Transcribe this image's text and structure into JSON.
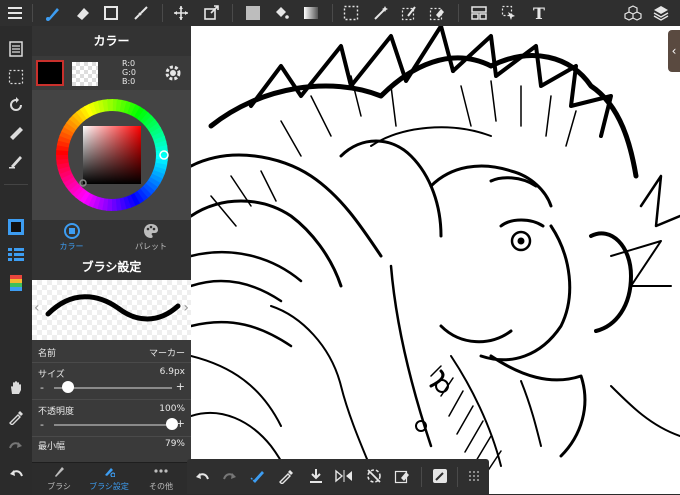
{
  "colors": {
    "accent": "#3d9df2",
    "foreground": "#000000",
    "background_swatch": "#ffffff"
  },
  "color_panel": {
    "title": "カラー",
    "rgb": {
      "r": "R:0",
      "g": "G:0",
      "b": "B:0"
    },
    "tabs": [
      {
        "label": "カラー",
        "icon": "color-circle-icon"
      },
      {
        "label": "パレット",
        "icon": "palette-icon"
      }
    ]
  },
  "brush_panel": {
    "title": "ブラシ設定",
    "name_label": "名前",
    "name_value": "マーカー",
    "size_label": "サイズ",
    "size_value": "6.9px",
    "size_level": 0.12,
    "opacity_label": "不透明度",
    "opacity_value": "100%",
    "opacity_level": 1.0,
    "min_width_label": "最小幅",
    "min_width_value": "79%"
  },
  "bottom_tabs": [
    {
      "label": "ブラシ",
      "icon": "brush-icon"
    },
    {
      "label": "ブラシ設定",
      "icon": "brush-settings-icon"
    },
    {
      "label": "その他",
      "icon": "more-icon"
    }
  ],
  "toolbar_text_tool": "T"
}
